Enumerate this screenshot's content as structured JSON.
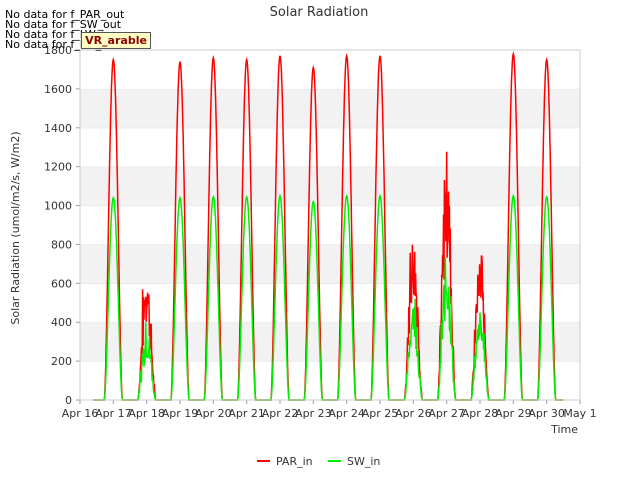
{
  "notices": [
    "No data for f_PAR_out",
    "No data for f_SW_out",
    "No data for f_LW_in",
    "No data for f_LW_out"
  ],
  "badge": "VR_arable",
  "chart_data": {
    "type": "line",
    "title": "Solar Radiation",
    "xlabel": "Time",
    "ylabel": "Solar Radiation (umol/m2/s, W/m2)",
    "xlim": [
      "Apr 16",
      "May 1"
    ],
    "ylim": [
      0,
      1800
    ],
    "yticks": [
      0,
      200,
      400,
      600,
      800,
      1000,
      1200,
      1400,
      1600,
      1800
    ],
    "x_tick_labels": [
      "Apr 16",
      "Apr 17",
      "Apr 18",
      "Apr 19",
      "Apr 20",
      "Apr 21",
      "Apr 22",
      "Apr 23",
      "Apr 24",
      "Apr 25",
      "Apr 26",
      "Apr 27",
      "Apr 28",
      "Apr 29",
      "Apr 30",
      "May 1"
    ],
    "grid": "horizontal bands",
    "legend_position": "bottom-center",
    "series": [
      {
        "name": "PAR_in",
        "color": "#ff0000",
        "daily_peak": [
          {
            "date": "Apr 17",
            "peak": 1750
          },
          {
            "date": "Apr 18",
            "peak": 700
          },
          {
            "date": "Apr 19",
            "peak": 1740
          },
          {
            "date": "Apr 20",
            "peak": 1760
          },
          {
            "date": "Apr 21",
            "peak": 1750
          },
          {
            "date": "Apr 22",
            "peak": 1770
          },
          {
            "date": "Apr 23",
            "peak": 1710
          },
          {
            "date": "Apr 24",
            "peak": 1770
          },
          {
            "date": "Apr 25",
            "peak": 1770
          },
          {
            "date": "Apr 26",
            "peak": 870
          },
          {
            "date": "Apr 27",
            "peak": 1300
          },
          {
            "date": "Apr 28",
            "peak": 740
          },
          {
            "date": "Apr 29",
            "peak": 1780
          },
          {
            "date": "Apr 30",
            "peak": 1750
          }
        ]
      },
      {
        "name": "SW_in",
        "color": "#00ee00",
        "daily_peak": [
          {
            "date": "Apr 17",
            "peak": 1040
          },
          {
            "date": "Apr 18",
            "peak": 410
          },
          {
            "date": "Apr 19",
            "peak": 1040
          },
          {
            "date": "Apr 20",
            "peak": 1045
          },
          {
            "date": "Apr 21",
            "peak": 1045
          },
          {
            "date": "Apr 22",
            "peak": 1050
          },
          {
            "date": "Apr 23",
            "peak": 1020
          },
          {
            "date": "Apr 24",
            "peak": 1050
          },
          {
            "date": "Apr 25",
            "peak": 1050
          },
          {
            "date": "Apr 26",
            "peak": 520
          },
          {
            "date": "Apr 27",
            "peak": 770
          },
          {
            "date": "Apr 28",
            "peak": 450
          },
          {
            "date": "Apr 29",
            "peak": 1050
          },
          {
            "date": "Apr 30",
            "peak": 1045
          }
        ]
      }
    ]
  }
}
